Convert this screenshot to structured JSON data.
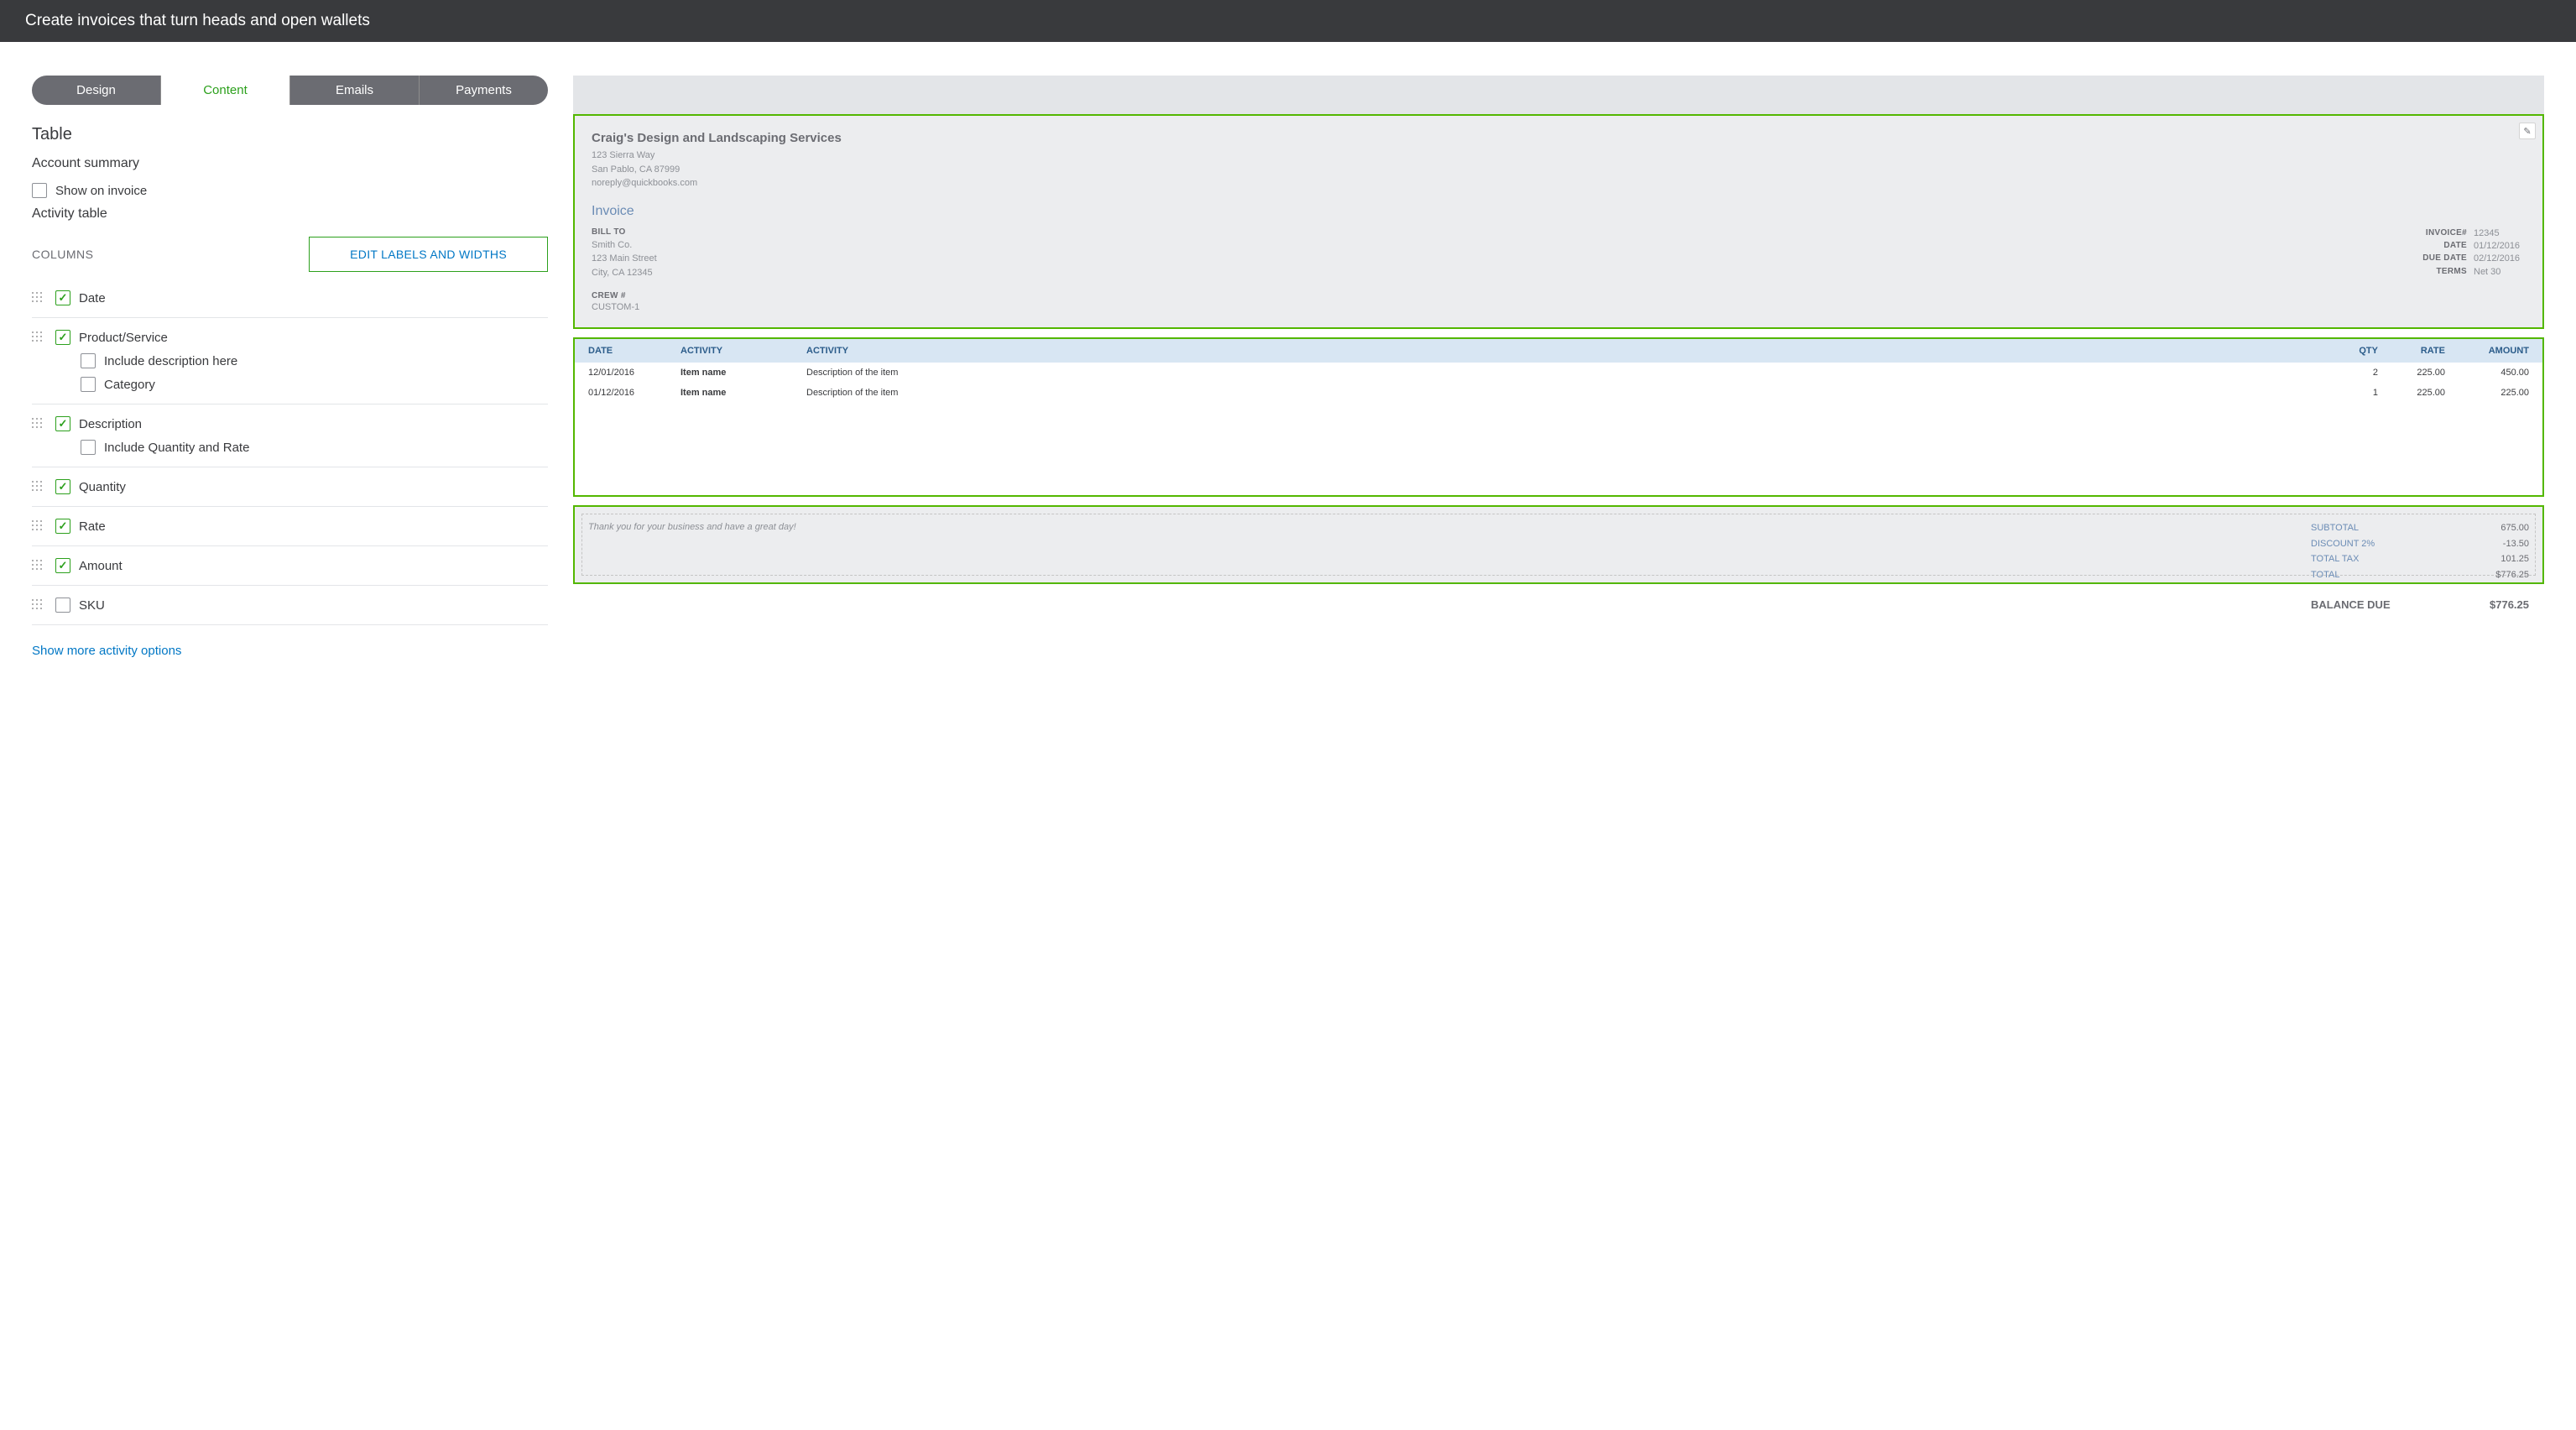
{
  "header": {
    "title": "Create invoices that turn heads and open wallets"
  },
  "tabs": {
    "design": "Design",
    "content": "Content",
    "emails": "Emails",
    "payments": "Payments"
  },
  "left": {
    "table": "Table",
    "accountSummary": "Account summary",
    "showOnInvoice": "Show on invoice",
    "activityTable": "Activity table",
    "columns": "COLUMNS",
    "editLabels": "EDIT LABELS AND WIDTHS",
    "colDate": "Date",
    "colProduct": "Product/Service",
    "colProductDesc": "Include description here",
    "colProductCat": "Category",
    "colDescription": "Description",
    "colDescQtyRate": "Include Quantity and Rate",
    "colQuantity": "Quantity",
    "colRate": "Rate",
    "colAmount": "Amount",
    "colSku": "SKU",
    "showMore": "Show more activity options"
  },
  "preview": {
    "company": {
      "name": "Craig's Design and Landscaping Services",
      "addr1": "123 Sierra Way",
      "addr2": "San Pablo, CA 87999",
      "email": "noreply@quickbooks.com"
    },
    "invoiceTitle": "Invoice",
    "billToLabel": "BILL TO",
    "billTo": {
      "name": "Smith Co.",
      "addr1": "123 Main Street",
      "addr2": "City, CA 12345"
    },
    "details": {
      "invoiceNumLabel": "INVOICE#",
      "invoiceNum": "12345",
      "dateLabel": "DATE",
      "date": "01/12/2016",
      "dueDateLabel": "DUE DATE",
      "dueDate": "02/12/2016",
      "termsLabel": "TERMS",
      "terms": "Net 30"
    },
    "crewLabel": "CREW #",
    "crewValue": "CUSTOM-1",
    "tableHeaders": {
      "date": "DATE",
      "activity1": "ACTIVITY",
      "activity2": "ACTIVITY",
      "qty": "QTY",
      "rate": "RATE",
      "amount": "AMOUNT"
    },
    "rows": [
      {
        "date": "12/01/2016",
        "activity1": "Item name",
        "activity2": "Description of the item",
        "qty": "2",
        "rate": "225.00",
        "amount": "450.00"
      },
      {
        "date": "01/12/2016",
        "activity1": "Item name",
        "activity2": "Description of the item",
        "qty": "1",
        "rate": "225.00",
        "amount": "225.00"
      }
    ],
    "thankYou": "Thank you for your business and have a great day!",
    "totals": {
      "subtotalLabel": "SUBTOTAL",
      "subtotal": "675.00",
      "discountLabel": "DISCOUNT 2%",
      "discount": "-13.50",
      "taxLabel": "TOTAL TAX",
      "tax": "101.25",
      "totalLabel": "TOTAL",
      "total": "$776.25",
      "balanceLabel": "BALANCE DUE",
      "balance": "$776.25"
    }
  }
}
